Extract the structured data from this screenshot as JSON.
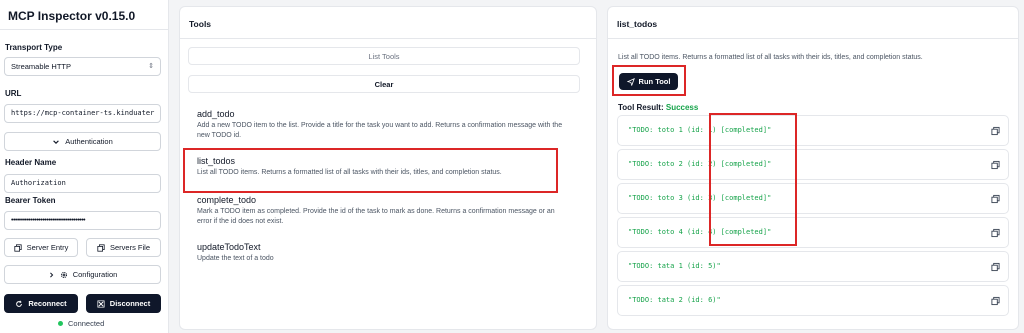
{
  "sidebar": {
    "app_title": "MCP Inspector v0.15.0",
    "transport_label": "Transport Type",
    "transport_value": "Streamable HTTP",
    "url_label": "URL",
    "url_value": "https://mcp-container-ts.kinduater",
    "auth_button": "Authentication",
    "header_name_label": "Header Name",
    "header_name_value": "Authorization",
    "bearer_label": "Bearer Token",
    "bearer_value": "••••••••••••••••••••••••••••••••••••••",
    "server_entry_button": "Server Entry",
    "servers_file_button": "Servers File",
    "configuration_button": "Configuration",
    "reconnect_button": "Reconnect",
    "disconnect_button": "Disconnect",
    "status_text": "Connected"
  },
  "tools_panel": {
    "title": "Tools",
    "list_tools_button": "List Tools",
    "clear_button": "Clear",
    "items": [
      {
        "name": "add_todo",
        "description": "Add a new TODO item to the list. Provide a title for the task you want to add. Returns a confirmation message with the new TODO id."
      },
      {
        "name": "list_todos",
        "description": "List all TODO items. Returns a formatted list of all tasks with their ids, titles, and completion status."
      },
      {
        "name": "complete_todo",
        "description": "Mark a TODO item as completed. Provide the id of the task to mark as done. Returns a confirmation message or an error if the id does not exist."
      },
      {
        "name": "updateTodoText",
        "description": "Update the text of a todo"
      }
    ]
  },
  "result_panel": {
    "title": "list_todos",
    "description": "List all TODO items. Returns a formatted list of all tasks with their ids, titles, and completion status.",
    "run_button": "Run Tool",
    "result_label": "Tool Result:",
    "result_status": "Success",
    "results": [
      "\"TODO: toto 1 (id: 1) [completed]\"",
      "\"TODO: toto 2 (id: 2) [completed]\"",
      "\"TODO: toto 3 (id: 3) [completed]\"",
      "\"TODO: toto 4 (id: 4) [completed]\"",
      "\"TODO: tata 1 (id: 5)\"",
      "\"TODO: tata 2 (id: 6)\""
    ]
  },
  "colors": {
    "accent_dark": "#0f172a",
    "success": "#16a34a",
    "highlight": "#dc2626",
    "status_dot": "#22c55e"
  },
  "icons": [
    "chevron-updown-icon",
    "chevron-down-icon",
    "chevron-right-icon",
    "copy-icon",
    "gear-icon",
    "send-icon",
    "reconnect-icon",
    "disconnect-icon"
  ]
}
